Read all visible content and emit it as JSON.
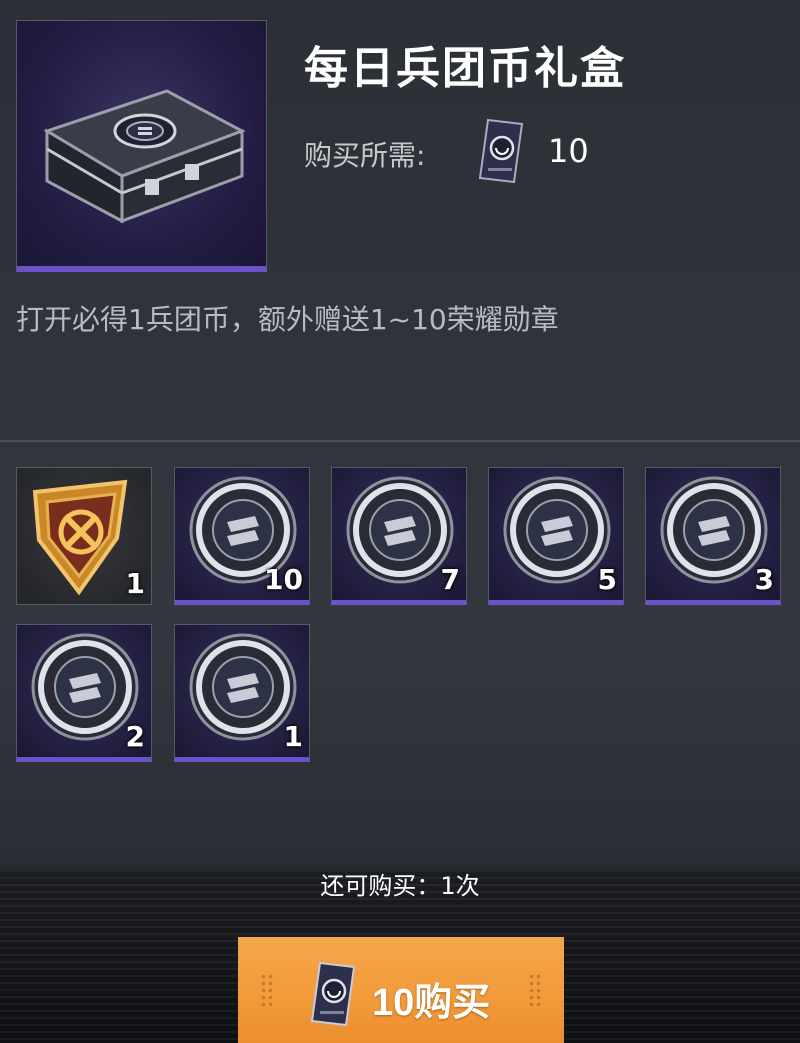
{
  "item": {
    "title": "每日兵团币礼盒",
    "price_label": "购买所需:",
    "price_value": "10",
    "price_icon": "legion-coin-card-icon",
    "description": "打开必得1兵团币，额外赠送1~10荣耀勋章",
    "hero_icon": "gift-case-icon"
  },
  "rewards": [
    {
      "icon": "gold-emblem-icon",
      "qty": "1"
    },
    {
      "icon": "silver-medal-icon",
      "qty": "10"
    },
    {
      "icon": "silver-medal-icon",
      "qty": "7"
    },
    {
      "icon": "silver-medal-icon",
      "qty": "5"
    },
    {
      "icon": "silver-medal-icon",
      "qty": "3"
    },
    {
      "icon": "silver-medal-icon",
      "qty": "2"
    },
    {
      "icon": "silver-medal-icon",
      "qty": "1"
    }
  ],
  "purchase": {
    "remaining_label": "还可购买：",
    "remaining_value": "1次",
    "button_label": "10购买"
  },
  "colors": {
    "accent_purple": "#6b52c8",
    "button_orange": "#f19a3a"
  }
}
